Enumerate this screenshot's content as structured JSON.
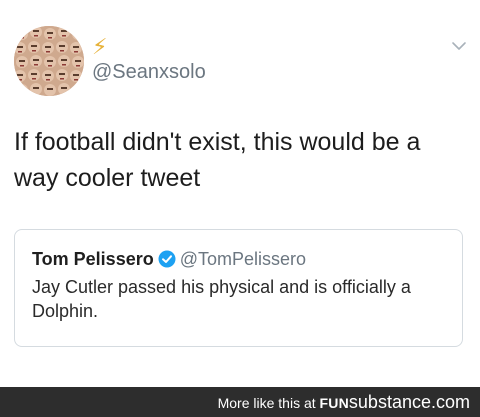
{
  "tweet": {
    "handle": "@Seanxsolo",
    "name_icon": "⚡",
    "text": "If football didn't exist, this would be a way cooler tweet",
    "avatar_icon": "avatar-collage",
    "menu_icon": "chevron-down-icon"
  },
  "quoted": {
    "name": "Tom Pelissero",
    "handle": "@TomPelissero",
    "verified_icon": "verified-badge-icon",
    "text": "Jay Cutler passed his physical and is officially a Dolphin."
  },
  "footer": {
    "prefix": "More like this at ",
    "brand_a": "FUN",
    "brand_b": "substance",
    "brand_c": ".com"
  },
  "colors": {
    "verified": "#1da1f2",
    "handle": "#6b7680",
    "footer_bg": "#2d2d2d"
  }
}
